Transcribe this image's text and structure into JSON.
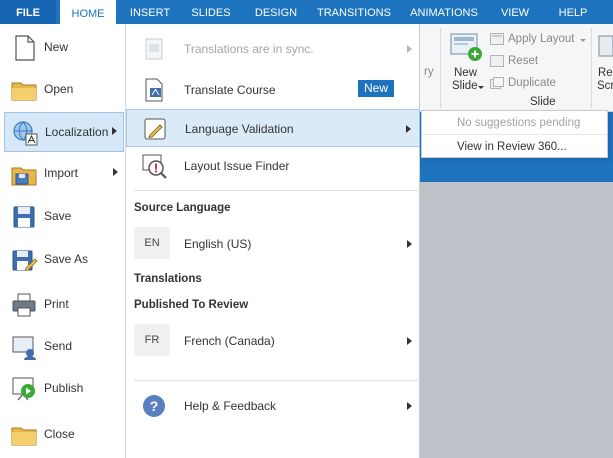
{
  "ribbon": {
    "tabs": [
      {
        "label": "FILE"
      },
      {
        "label": "HOME"
      },
      {
        "label": "INSERT"
      },
      {
        "label": "SLIDES"
      },
      {
        "label": "DESIGN"
      },
      {
        "label": "TRANSITIONS"
      },
      {
        "label": "ANIMATIONS"
      },
      {
        "label": "VIEW"
      },
      {
        "label": "HELP"
      }
    ],
    "slide_group": {
      "new_slide_line1": "New",
      "new_slide_line2": "Slide",
      "apply_layout": "Apply Layout",
      "reset": "Reset",
      "duplicate": "Duplicate",
      "group_label": "Slide",
      "partial_left": "ry",
      "partial_right_1": "Re",
      "partial_right_2": "Scr"
    }
  },
  "file_menu": {
    "items": [
      {
        "label": "New",
        "icon": "new-file-icon"
      },
      {
        "label": "Open",
        "icon": "folder-icon"
      },
      {
        "label": "Localization",
        "icon": "localization-icon"
      },
      {
        "label": "Import",
        "icon": "import-icon"
      },
      {
        "label": "Save",
        "icon": "save-icon"
      },
      {
        "label": "Save As",
        "icon": "save-as-icon"
      },
      {
        "label": "Print",
        "icon": "printer-icon"
      },
      {
        "label": "Send",
        "icon": "send-icon"
      },
      {
        "label": "Publish",
        "icon": "publish-icon"
      },
      {
        "label": "Close",
        "icon": "close-folder-icon"
      }
    ]
  },
  "localization_menu": {
    "sync_status": "Translations are in sync.",
    "translate_course": "Translate Course",
    "new_badge": "New",
    "language_validation": "Language Validation",
    "layout_issue_finder": "Layout Issue Finder",
    "source_language_heading": "Source Language",
    "source_language_code": "EN",
    "source_language": "English (US)",
    "translations_heading": "Translations",
    "published_heading": "Published To Review",
    "published_language_code": "FR",
    "published_language": "French (Canada)",
    "help": "Help & Feedback"
  },
  "flyout": {
    "no_suggestions": "No suggestions pending",
    "view_in_review": "View in Review 360..."
  },
  "colors": {
    "accent": "#1e73be",
    "highlight": "#dbeaf7"
  }
}
